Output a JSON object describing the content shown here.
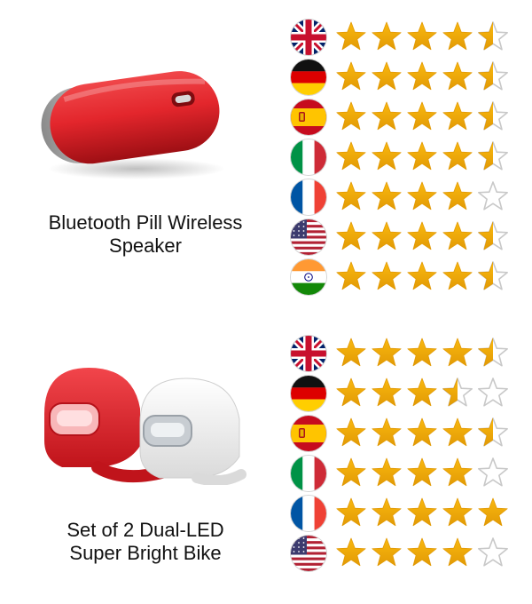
{
  "colors": {
    "star_gold": "#F9B90F",
    "star_gold_dark": "#E29A05",
    "star_outline": "#C8C8C8",
    "speaker_red": "#E3262C",
    "light_red": "#E0222A",
    "light_white": "#F2F2F2"
  },
  "products": [
    {
      "title_line1": "Bluetooth Pill Wireless",
      "title_line2": "Speaker",
      "image_icon": "red-pill-speaker",
      "ratings": [
        {
          "country": "uk",
          "flag_icon": "uk-flag-icon",
          "stars": 4.5,
          "max": 5
        },
        {
          "country": "germany",
          "flag_icon": "germany-flag-icon",
          "stars": 4.5,
          "max": 5
        },
        {
          "country": "spain",
          "flag_icon": "spain-flag-icon",
          "stars": 4.5,
          "max": 5
        },
        {
          "country": "italy",
          "flag_icon": "italy-flag-icon",
          "stars": 4.5,
          "max": 5
        },
        {
          "country": "france",
          "flag_icon": "france-flag-icon",
          "stars": 4,
          "max": 5
        },
        {
          "country": "usa",
          "flag_icon": "usa-flag-icon",
          "stars": 4.5,
          "max": 5
        },
        {
          "country": "india",
          "flag_icon": "india-flag-icon",
          "stars": 4.5,
          "max": 5
        }
      ]
    },
    {
      "title_line1": "Set of 2 Dual-LED",
      "title_line2": "Super Bright Bike",
      "image_icon": "silicone-bike-lights",
      "ratings": [
        {
          "country": "uk",
          "flag_icon": "uk-flag-icon",
          "stars": 4.5,
          "max": 5
        },
        {
          "country": "germany",
          "flag_icon": "germany-flag-icon",
          "stars": 3.5,
          "max": 5
        },
        {
          "country": "spain",
          "flag_icon": "spain-flag-icon",
          "stars": 4.5,
          "max": 5
        },
        {
          "country": "italy",
          "flag_icon": "italy-flag-icon",
          "stars": 4,
          "max": 5
        },
        {
          "country": "france",
          "flag_icon": "france-flag-icon",
          "stars": 5,
          "max": 5
        },
        {
          "country": "usa",
          "flag_icon": "usa-flag-icon",
          "stars": 4,
          "max": 5
        }
      ]
    }
  ]
}
